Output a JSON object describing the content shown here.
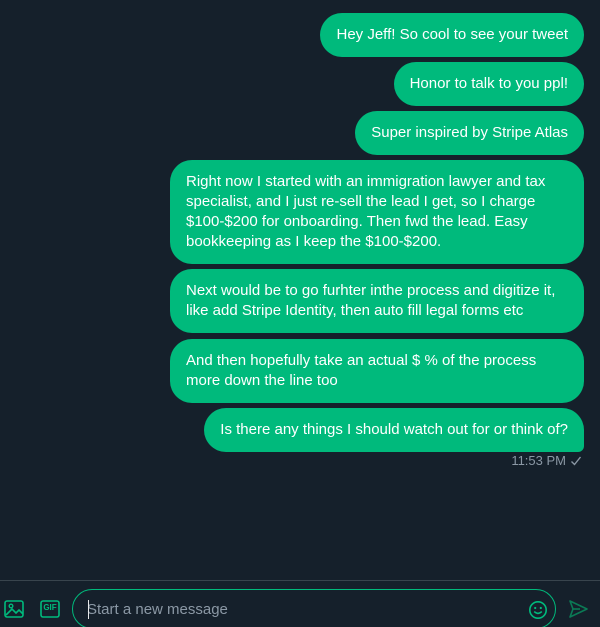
{
  "colors": {
    "background": "#15202b",
    "bubble": "#00ba7c",
    "bubble_text": "#ffffff",
    "muted": "#8b98a5",
    "accent": "#00ba7c"
  },
  "messages": [
    {
      "text": "Hey Jeff! So cool to see your tweet"
    },
    {
      "text": "Honor to talk to you ppl!"
    },
    {
      "text": "Super inspired by Stripe Atlas"
    },
    {
      "text": "Right now I started with an immigration lawyer and tax specialist, and I just re-sell the lead I get, so I charge $100-$200 for onboarding. Then fwd the lead. Easy bookkeeping as I keep the $100-$200."
    },
    {
      "text": "Next would be to go furhter inthe process and digitize it, like add Stripe Identity, then auto fill legal forms etc"
    },
    {
      "text": "And then hopefully take an actual $ % of the process more down the line too"
    },
    {
      "text": "Is there any things I should watch out for or think of?"
    }
  ],
  "status": {
    "time": "11:53 PM",
    "icon": "checkmark-icon"
  },
  "composer": {
    "placeholder": "Start a new message",
    "value": "",
    "media_icon": "image-icon",
    "gif_label": "GIF",
    "emoji_icon": "emoji-icon",
    "send_icon": "send-icon"
  }
}
